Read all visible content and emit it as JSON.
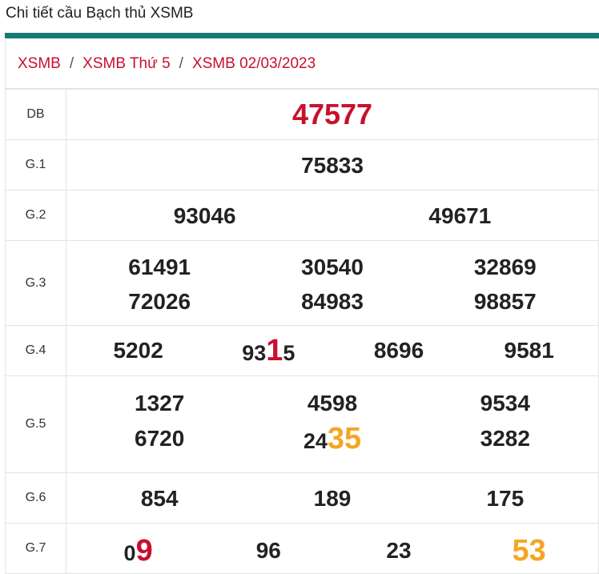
{
  "page": {
    "title": "Chi tiết cầu Bạch thủ XSMB"
  },
  "breadcrumb": {
    "items": [
      "XSMB",
      "XSMB Thứ 5",
      "XSMB 02/03/2023"
    ],
    "separator": "/"
  },
  "colors": {
    "accent_bar": "#147a75",
    "red": "#c8102e",
    "orange": "#f5a623"
  },
  "prizes": {
    "db": {
      "label": "DB",
      "values": [
        "47577"
      ]
    },
    "g1": {
      "label": "G.1",
      "values": [
        "75833"
      ]
    },
    "g2": {
      "label": "G.2",
      "values": [
        "93046",
        "49671"
      ]
    },
    "g3": {
      "label": "G.3",
      "values": [
        "61491",
        "30540",
        "32869",
        "72026",
        "84983",
        "98857"
      ]
    },
    "g4": {
      "label": "G.4",
      "values": [
        "5202",
        "8696",
        "9581"
      ],
      "highlighted": {
        "prefix": "93",
        "highlight": "1",
        "suffix": "5"
      }
    },
    "g5": {
      "label": "G.5",
      "values": [
        "1327",
        "4598",
        "9534",
        "6720",
        "3282"
      ],
      "highlighted": {
        "prefix": "24",
        "highlight": "35"
      }
    },
    "g6": {
      "label": "G.6",
      "values": [
        "854",
        "189",
        "175"
      ]
    },
    "g7": {
      "label": "G.7",
      "values": [
        "96",
        "23",
        "53"
      ],
      "highlighted": {
        "prefix": "0",
        "highlight": "9"
      }
    }
  }
}
